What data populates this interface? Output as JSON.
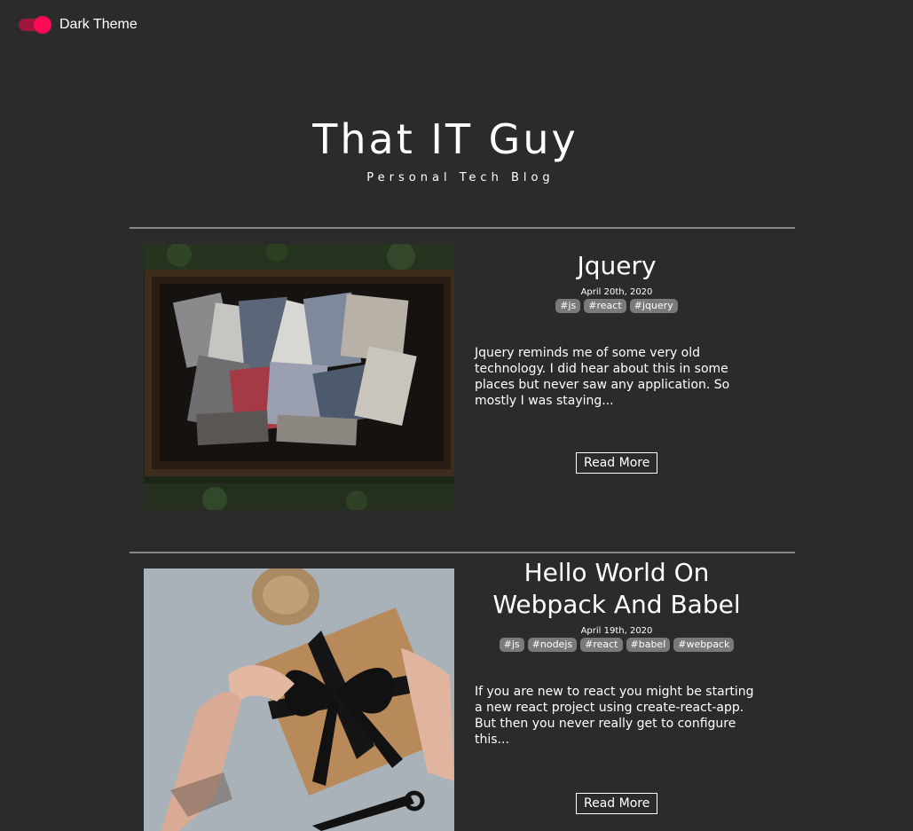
{
  "theme_toggle": {
    "label": "Dark Theme",
    "on": true,
    "accent": "#ff0a55"
  },
  "header": {
    "title": "That IT Guy",
    "subtitle": "Personal Tech Blog"
  },
  "posts": [
    {
      "title": "Jquery",
      "date": "April 20th, 2020",
      "tags": [
        "#js",
        "#react",
        "#jquery"
      ],
      "excerpt": "Jquery reminds me of some very old technology. I did hear about this in some places but never saw any application. So mostly I was staying...",
      "read_more": "Read More",
      "image": "box-of-old-photographs"
    },
    {
      "title": "Hello World On Webpack And Babel",
      "date": "April 19th, 2020",
      "tags": [
        "#js",
        "#nodejs",
        "#react",
        "#babel",
        "#webpack"
      ],
      "excerpt": "If you are new to react you might be starting a new react project using create-react-app. But then you never really get to configure this...",
      "read_more": "Read More",
      "image": "hands-tying-ribbon-on-gift-box"
    }
  ],
  "colors": {
    "background": "#2b2b2b",
    "text": "#ffffff",
    "tag_bg": "#7a7a7a",
    "divider": "#888888"
  }
}
